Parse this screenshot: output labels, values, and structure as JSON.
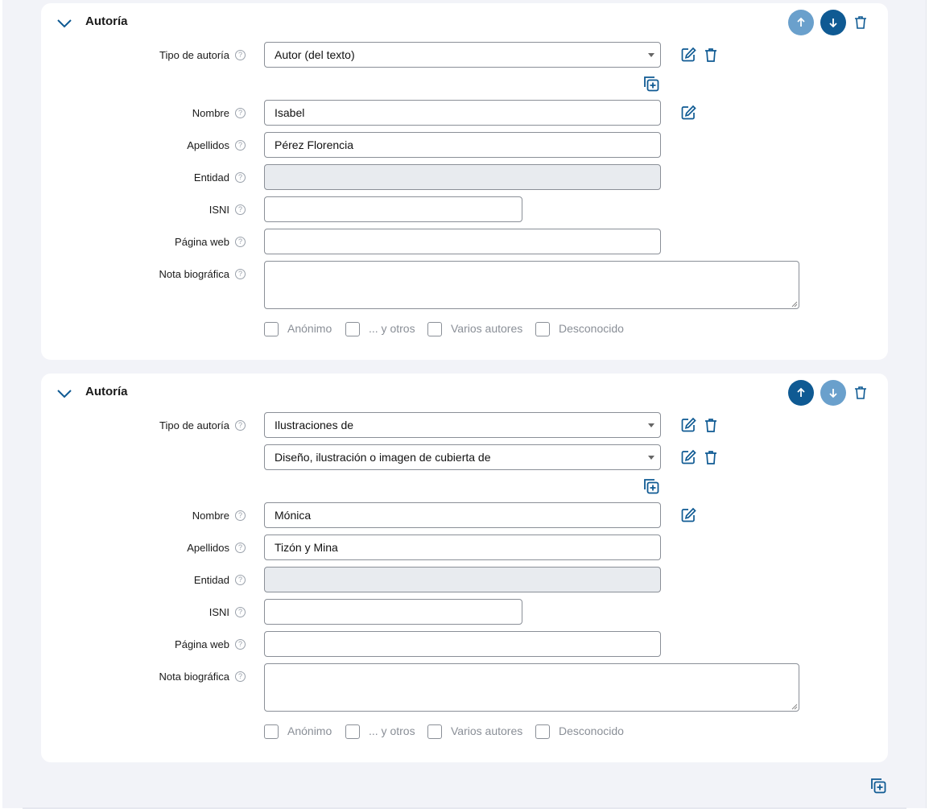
{
  "sections": [
    {
      "title": "Autoría",
      "tipo_label": "Tipo de autoría",
      "tipo_values": [
        "Autor (del texto)"
      ],
      "nombre_label": "Nombre",
      "nombre_value": "Isabel",
      "apellidos_label": "Apellidos",
      "apellidos_value": "Pérez Florencia",
      "entidad_label": "Entidad",
      "entidad_value": "",
      "isni_label": "ISNI",
      "isni_value": "",
      "web_label": "Página web",
      "web_value": "",
      "nota_label": "Nota biográfica",
      "nota_value": "",
      "checkboxes": [
        "Anónimo",
        "... y otros",
        "Varios autores",
        "Desconocido"
      ],
      "move_up_enabled": false,
      "move_down_enabled": true
    },
    {
      "title": "Autoría",
      "tipo_label": "Tipo de autoría",
      "tipo_values": [
        "Ilustraciones de",
        "Diseño, ilustración o imagen de cubierta de"
      ],
      "nombre_label": "Nombre",
      "nombre_value": "Mónica",
      "apellidos_label": "Apellidos",
      "apellidos_value": "Tizón y Mina",
      "entidad_label": "Entidad",
      "entidad_value": "",
      "isni_label": "ISNI",
      "isni_value": "",
      "web_label": "Página web",
      "web_value": "",
      "nota_label": "Nota biográfica",
      "nota_value": "",
      "checkboxes": [
        "Anónimo",
        "... y otros",
        "Varios autores",
        "Desconocido"
      ],
      "move_up_enabled": true,
      "move_down_enabled": false
    }
  ],
  "help_glyph": "?",
  "colors": {
    "primary": "#0f5a93",
    "primary_disabled": "#6aa0cc",
    "background": "#f2f3f8",
    "card": "#ffffff",
    "disabled_field": "#e8ebef"
  },
  "icons": {
    "collapse": "chevron-down-icon",
    "move_up": "arrow-up-icon",
    "move_down": "arrow-down-icon",
    "delete": "trash-icon",
    "edit": "edit-icon",
    "add": "add-copy-icon"
  }
}
